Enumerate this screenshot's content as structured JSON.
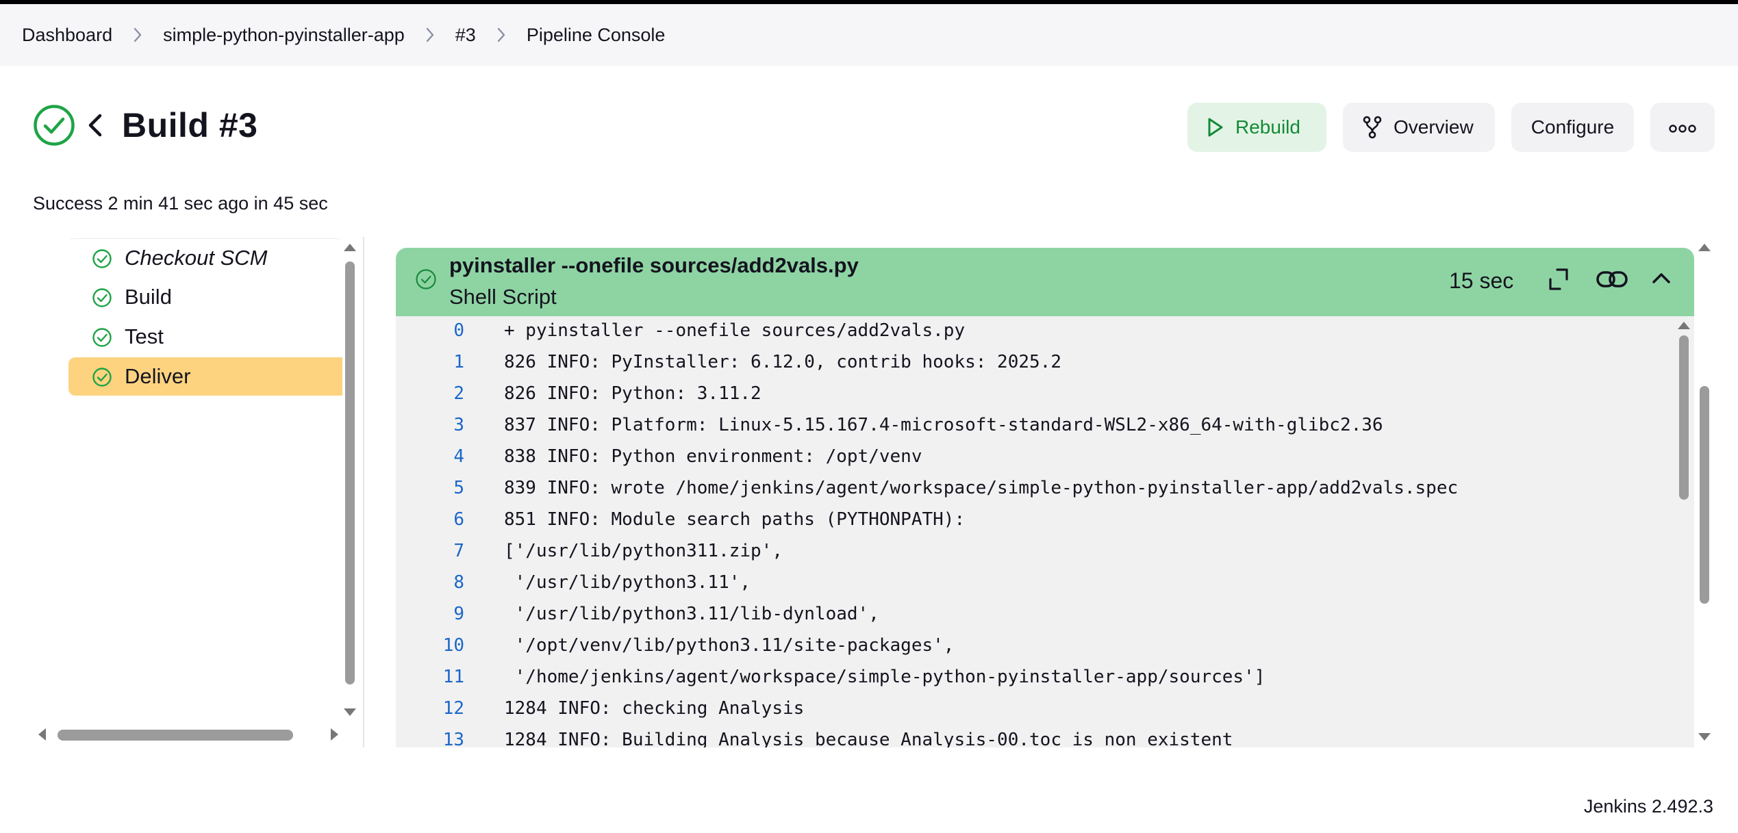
{
  "breadcrumb": {
    "items": [
      {
        "label": "Dashboard"
      },
      {
        "label": "simple-python-pyinstaller-app"
      },
      {
        "label": "#3"
      },
      {
        "label": "Pipeline Console"
      }
    ]
  },
  "header": {
    "title": "Build #3",
    "status_text": "Success 2 min 41 sec ago in 45 sec",
    "status_icon": "check-circle-icon",
    "status_color": "#1ea446"
  },
  "actions": {
    "rebuild_label": "Rebuild",
    "overview_label": "Overview",
    "configure_label": "Configure"
  },
  "stages": [
    {
      "label": "Checkout SCM",
      "status": "success"
    },
    {
      "label": "Build",
      "status": "success"
    },
    {
      "label": "Test",
      "status": "success"
    },
    {
      "label": "Deliver",
      "status": "success",
      "selected": true
    }
  ],
  "step": {
    "title": "pyinstaller --onefile sources/add2vals.py",
    "subtitle": "Shell Script",
    "duration": "15 sec"
  },
  "log": [
    {
      "n": "0",
      "text": "+ pyinstaller --onefile sources/add2vals.py"
    },
    {
      "n": "1",
      "text": "826 INFO: PyInstaller: 6.12.0, contrib hooks: 2025.2"
    },
    {
      "n": "2",
      "text": "826 INFO: Python: 3.11.2"
    },
    {
      "n": "3",
      "text": "837 INFO: Platform: Linux-5.15.167.4-microsoft-standard-WSL2-x86_64-with-glibc2.36"
    },
    {
      "n": "4",
      "text": "838 INFO: Python environment: /opt/venv"
    },
    {
      "n": "5",
      "text": "839 INFO: wrote /home/jenkins/agent/workspace/simple-python-pyinstaller-app/add2vals.spec"
    },
    {
      "n": "6",
      "text": "851 INFO: Module search paths (PYTHONPATH):"
    },
    {
      "n": "7",
      "text": "['/usr/lib/python311.zip',"
    },
    {
      "n": "8",
      "text": " '/usr/lib/python3.11',"
    },
    {
      "n": "9",
      "text": " '/usr/lib/python3.11/lib-dynload',"
    },
    {
      "n": "10",
      "text": " '/opt/venv/lib/python3.11/site-packages',"
    },
    {
      "n": "11",
      "text": " '/home/jenkins/agent/workspace/simple-python-pyinstaller-app/sources']"
    },
    {
      "n": "12",
      "text": "1284 INFO: checking Analysis"
    },
    {
      "n": "13",
      "text": "1284 INFO: Building Analysis because Analysis-00.toc is non existent"
    }
  ],
  "footer": {
    "version": "Jenkins 2.492.3"
  },
  "colors": {
    "accent_green": "#1ea446",
    "header_green": "#8ed4a3",
    "selected_stage": "#fdd380",
    "line_number_blue": "#1a67c9"
  }
}
